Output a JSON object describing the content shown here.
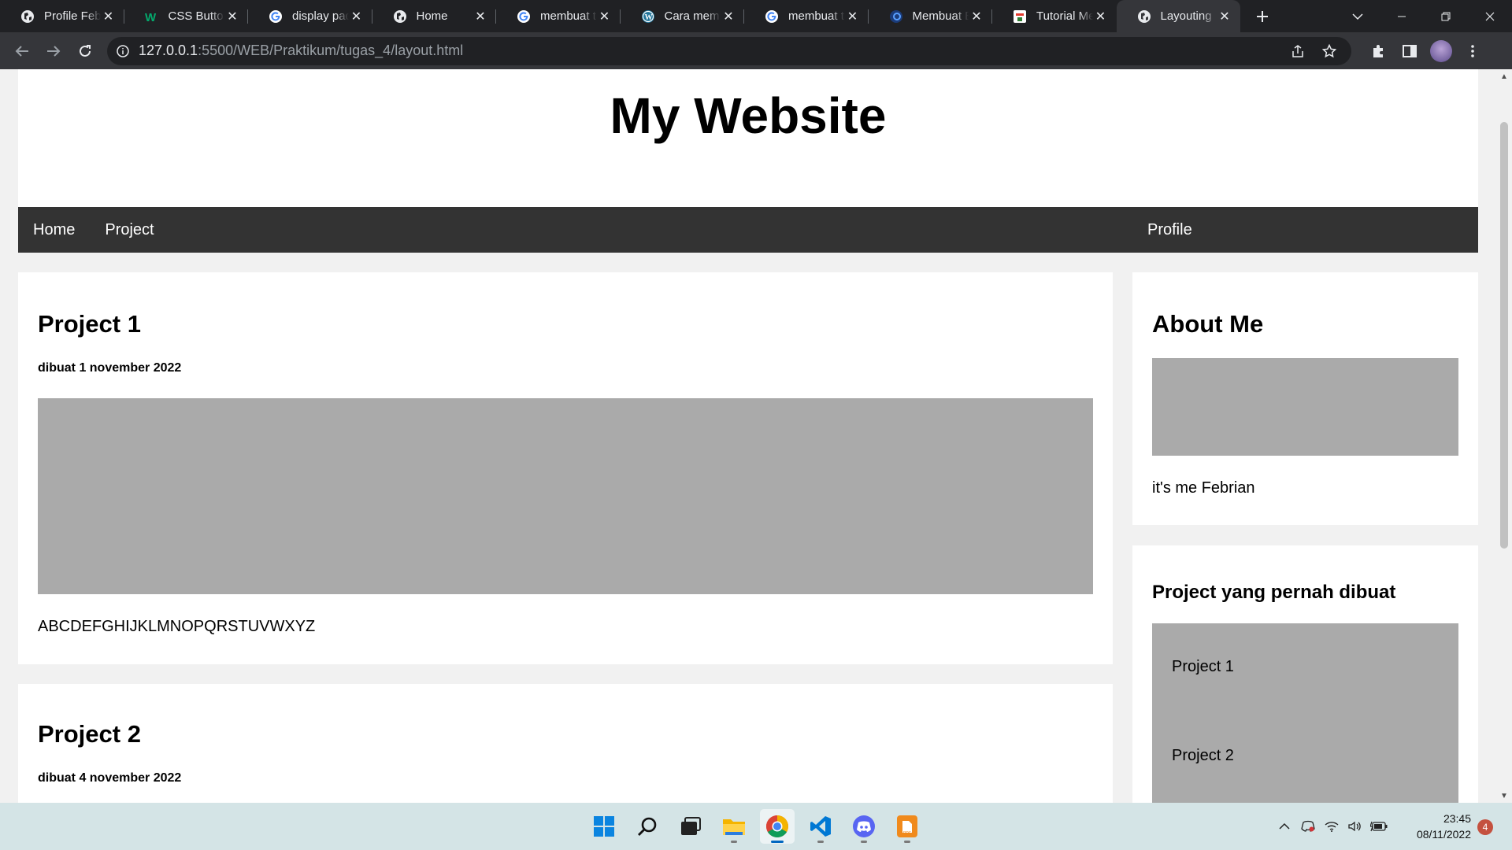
{
  "browser": {
    "tabs": [
      {
        "title": "Profile Febrian",
        "icon": "globe-icon"
      },
      {
        "title": "CSS Buttons",
        "icon": "w3schools-icon"
      },
      {
        "title": "display padding",
        "icon": "google-icon"
      },
      {
        "title": "Home",
        "icon": "globe-icon"
      },
      {
        "title": "membuat tab",
        "icon": "google-icon"
      },
      {
        "title": "Cara membuat",
        "icon": "wordpress-icon"
      },
      {
        "title": "membuat tab",
        "icon": "google-icon"
      },
      {
        "title": "Membuat Elemen",
        "icon": "site-icon"
      },
      {
        "title": "Tutorial Membuat",
        "icon": "tutorial-icon"
      },
      {
        "title": "Layouting",
        "icon": "globe-icon",
        "active": true
      }
    ],
    "url_host": "127.0.0.1",
    "url_path": ":5500/WEB/Praktikum/tugas_4/layout.html"
  },
  "page": {
    "site_title": "My Website",
    "nav": {
      "home": "Home",
      "project": "Project",
      "profile": "Profile"
    },
    "projects": [
      {
        "title": "Project 1",
        "date": "dibuat 1 november 2022",
        "text": "ABCDEFGHIJKLMNOPQRSTUVWXYZ"
      },
      {
        "title": "Project 2",
        "date": "dibuat 4 november 2022"
      }
    ],
    "about": {
      "title": "About Me",
      "text": "it's me Febrian"
    },
    "side_projects": {
      "title": "Project yang pernah dibuat",
      "items": [
        "Project 1",
        "Project 2"
      ]
    }
  },
  "taskbar": {
    "apps": [
      "start-icon",
      "search-icon",
      "task-view-icon",
      "file-explorer-icon",
      "chrome-icon",
      "vscode-icon",
      "discord-icon",
      "pdf-app-icon"
    ],
    "time": "23:45",
    "date": "08/11/2022",
    "notifications": "4"
  },
  "colors": {
    "nav_bg": "#333333",
    "placeholder_gray": "#aaaaaa",
    "taskbar_bg": "#d4e4e6"
  }
}
